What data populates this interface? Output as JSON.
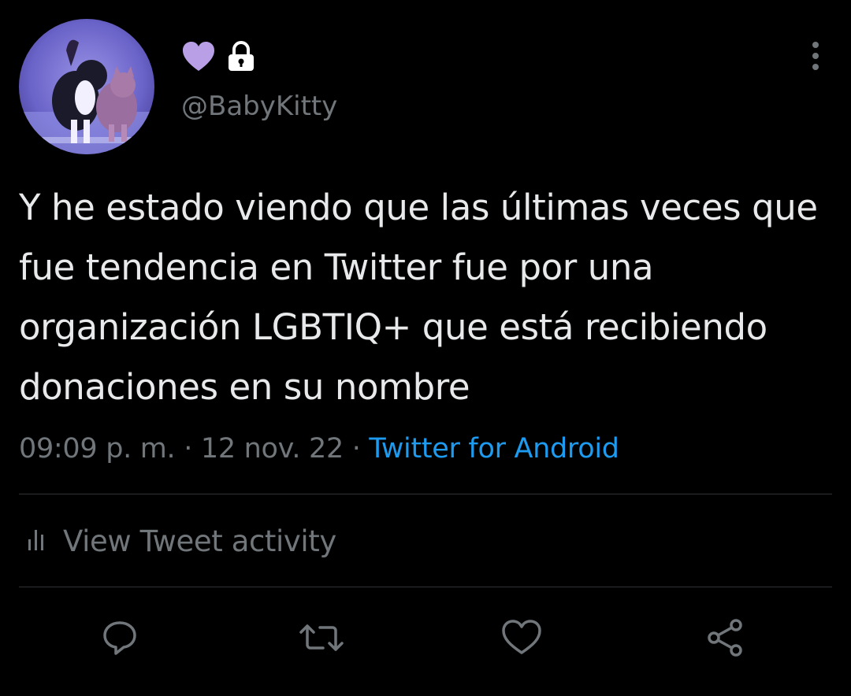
{
  "user": {
    "handle": "@BabyKitty",
    "name_icons": [
      "purple-heart-icon",
      "lock-icon"
    ],
    "heart_color": "#b9a0e6"
  },
  "tweet": {
    "text": "Y he estado viendo que las últimas veces que fue tendencia en Twitter fue por una organización LGBTIQ+ que está recibiendo donaciones en su nombre",
    "time": "09:09 p. m.",
    "separator": "·",
    "date": "12 nov. 22",
    "source": "Twitter for Android"
  },
  "activity": {
    "label": "View Tweet activity",
    "icon": "bar-chart-icon"
  },
  "actions": [
    "reply-icon",
    "retweet-icon",
    "like-icon",
    "share-icon"
  ],
  "colors": {
    "background": "#000000",
    "text": "#e7e9ea",
    "secondary": "#71767b",
    "link": "#1d9bf0",
    "divider": "#2f3336"
  }
}
